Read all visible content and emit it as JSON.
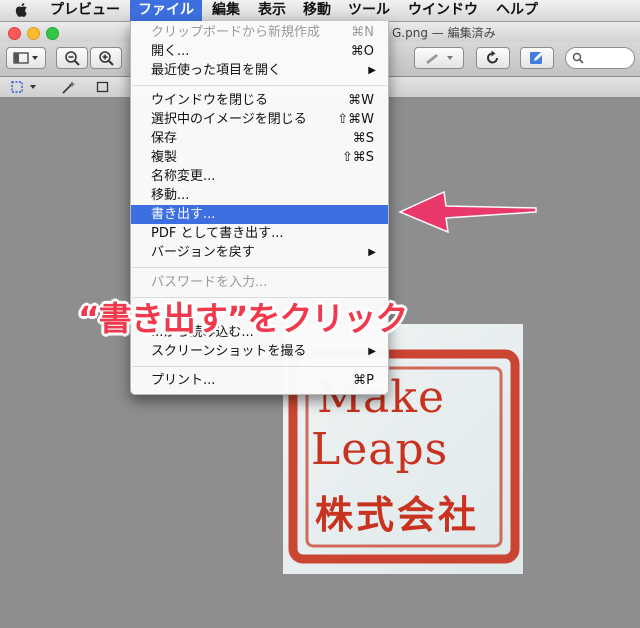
{
  "menubar": {
    "items": [
      "プレビュー",
      "ファイル",
      "編集",
      "表示",
      "移動",
      "ツール",
      "ウインドウ",
      "ヘルプ"
    ],
    "active_index": 1
  },
  "window": {
    "title": "G.png — 編集済み"
  },
  "file_menu": {
    "items": [
      {
        "label": "クリップボードから新規作成",
        "shortcut": "⌘N",
        "disabled": true
      },
      {
        "label": "開く...",
        "shortcut": "⌘O"
      },
      {
        "label": "最近使った項目を開く",
        "submenu": true
      },
      {
        "label": "ウインドウを閉じる",
        "shortcut": "⌘W"
      },
      {
        "label": "選択中のイメージを閉じる",
        "shortcut": "⇧⌘W"
      },
      {
        "label": "保存",
        "shortcut": "⌘S"
      },
      {
        "label": "複製",
        "shortcut": "⇧⌘S"
      },
      {
        "label": "名称変更..."
      },
      {
        "label": "移動..."
      },
      {
        "label": "書き出す...",
        "highlighted": true
      },
      {
        "label": "PDF として書き出す..."
      },
      {
        "label": "バージョンを戻す",
        "submenu": true
      },
      {
        "label": "パスワードを入力...",
        "disabled": true
      },
      {
        "label": "...から読み込む..."
      },
      {
        "label": "スクリーンショットを撮る",
        "submenu": true
      },
      {
        "label": "プリント...",
        "shortcut": "⌘P"
      }
    ]
  },
  "stamp": {
    "line1": "Make",
    "line2": "Leaps",
    "line3": "株式会社",
    "color": "#c8321e"
  },
  "annotation": {
    "text": "“書き出す”をクリック",
    "color": "#f0394c"
  },
  "icons": {
    "apple": "apple-icon",
    "sidebar": "sidebar-toggle-icon",
    "zoom_out": "zoom-out-icon",
    "zoom_in": "zoom-in-icon",
    "rotate": "rotate-icon",
    "edit": "edit-markup-icon",
    "search": "search-icon",
    "selection": "rect-selection-icon",
    "magic": "magic-wand-icon"
  }
}
